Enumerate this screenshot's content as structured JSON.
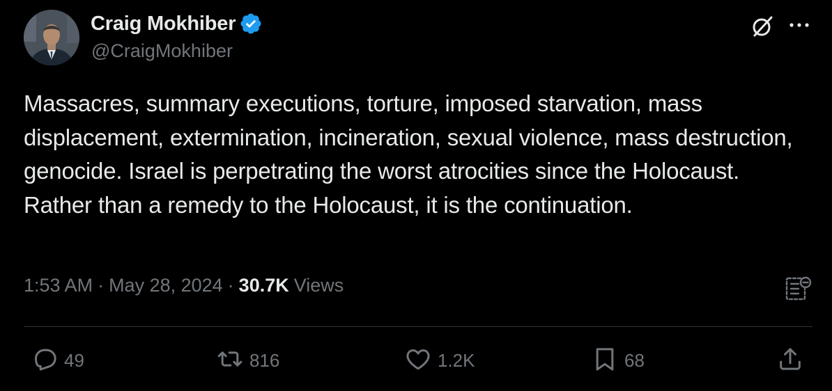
{
  "author": {
    "name": "Craig Mokhiber",
    "handle": "@CraigMokhiber",
    "verified": true,
    "verified_color": "#1d9bf0"
  },
  "tweet": {
    "text": "Massacres, summary executions, torture, imposed starvation, mass displacement, extermination, incineration, sexual violence, mass destruction, genocide. Israel is perpetrating the worst atrocities since the Holocaust. Rather than a remedy to the Holocaust, it is the continuation."
  },
  "meta": {
    "time": "1:53 AM",
    "separator": "·",
    "date": "May 28, 2024",
    "views_count": "30.7K",
    "views_label": "Views"
  },
  "actions": {
    "replies": "49",
    "reposts": "816",
    "likes": "1.2K",
    "bookmarks": "68"
  },
  "icons": {
    "header": [
      "grok-icon",
      "more-icon"
    ],
    "meta": [
      "analytics-icon"
    ],
    "actions": [
      "reply-icon",
      "repost-icon",
      "like-icon",
      "bookmark-icon",
      "share-icon"
    ]
  },
  "colors": {
    "background": "#000000",
    "text_primary": "#e7e9ea",
    "text_secondary": "#71767b",
    "divider": "#2f3336"
  }
}
